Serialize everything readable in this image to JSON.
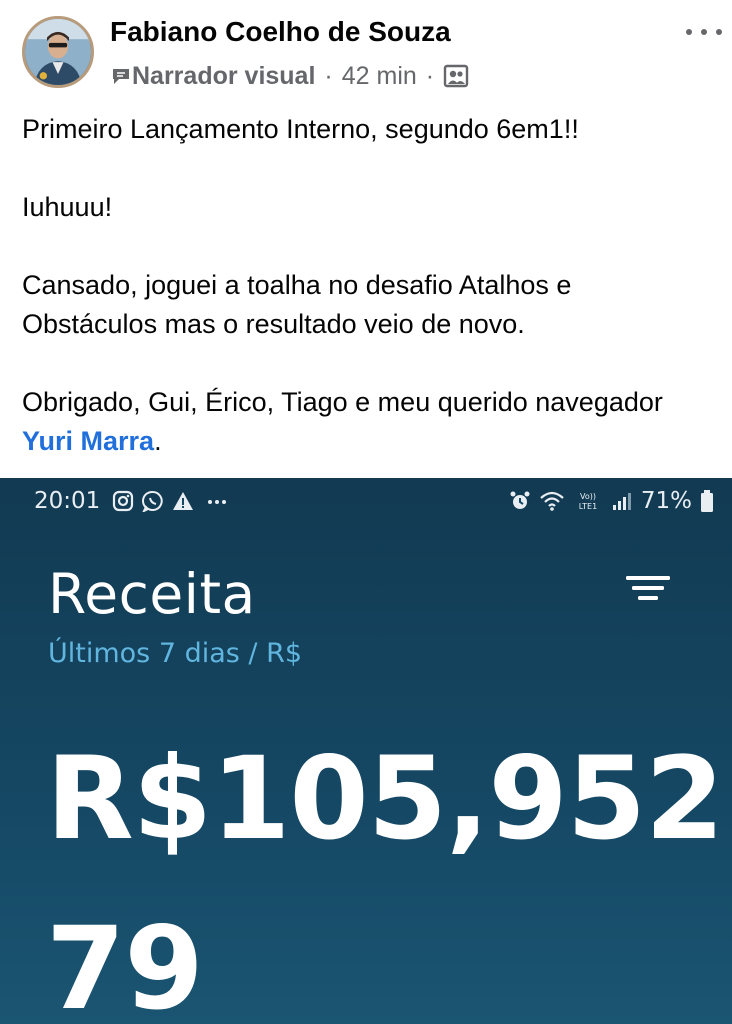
{
  "post": {
    "author": "Fabiano Coelho de Souza",
    "badge": "Narrador visual",
    "time": "42 min",
    "separator": "·",
    "paragraphs": [
      "Primeiro Lançamento Interno, segundo 6em1!!",
      "Iuhuuu!",
      "Cansado, joguei a toalha no desafio Atalhos e Obstáculos mas o resultado veio de novo."
    ],
    "last_paragraph_prefix": "Obrigado, Gui, Érico, Tiago e meu querido navegador ",
    "mention": "Yuri Marra",
    "last_paragraph_suffix": ".",
    "icons": {
      "badge": "speech-bubble-icon",
      "audience": "group-icon",
      "menu": "more-horizontal-icon"
    }
  },
  "photo": {
    "status_bar": {
      "time": "20:01",
      "battery": "71%",
      "left_icons": [
        "instagram-icon",
        "whatsapp-icon",
        "warning-icon",
        "more-dots-icon"
      ],
      "right_icons": [
        "alarm-icon",
        "wifi-icon",
        "volte-icon",
        "signal-icon",
        "battery-icon"
      ]
    },
    "title": "Receita",
    "subtitle": "Últimos 7 dias / R$",
    "amount_line1": "R$105,952.",
    "amount_line2": "79",
    "colors": {
      "background": "#154864",
      "subtitle": "#61b6df",
      "text": "#ffffff"
    }
  }
}
